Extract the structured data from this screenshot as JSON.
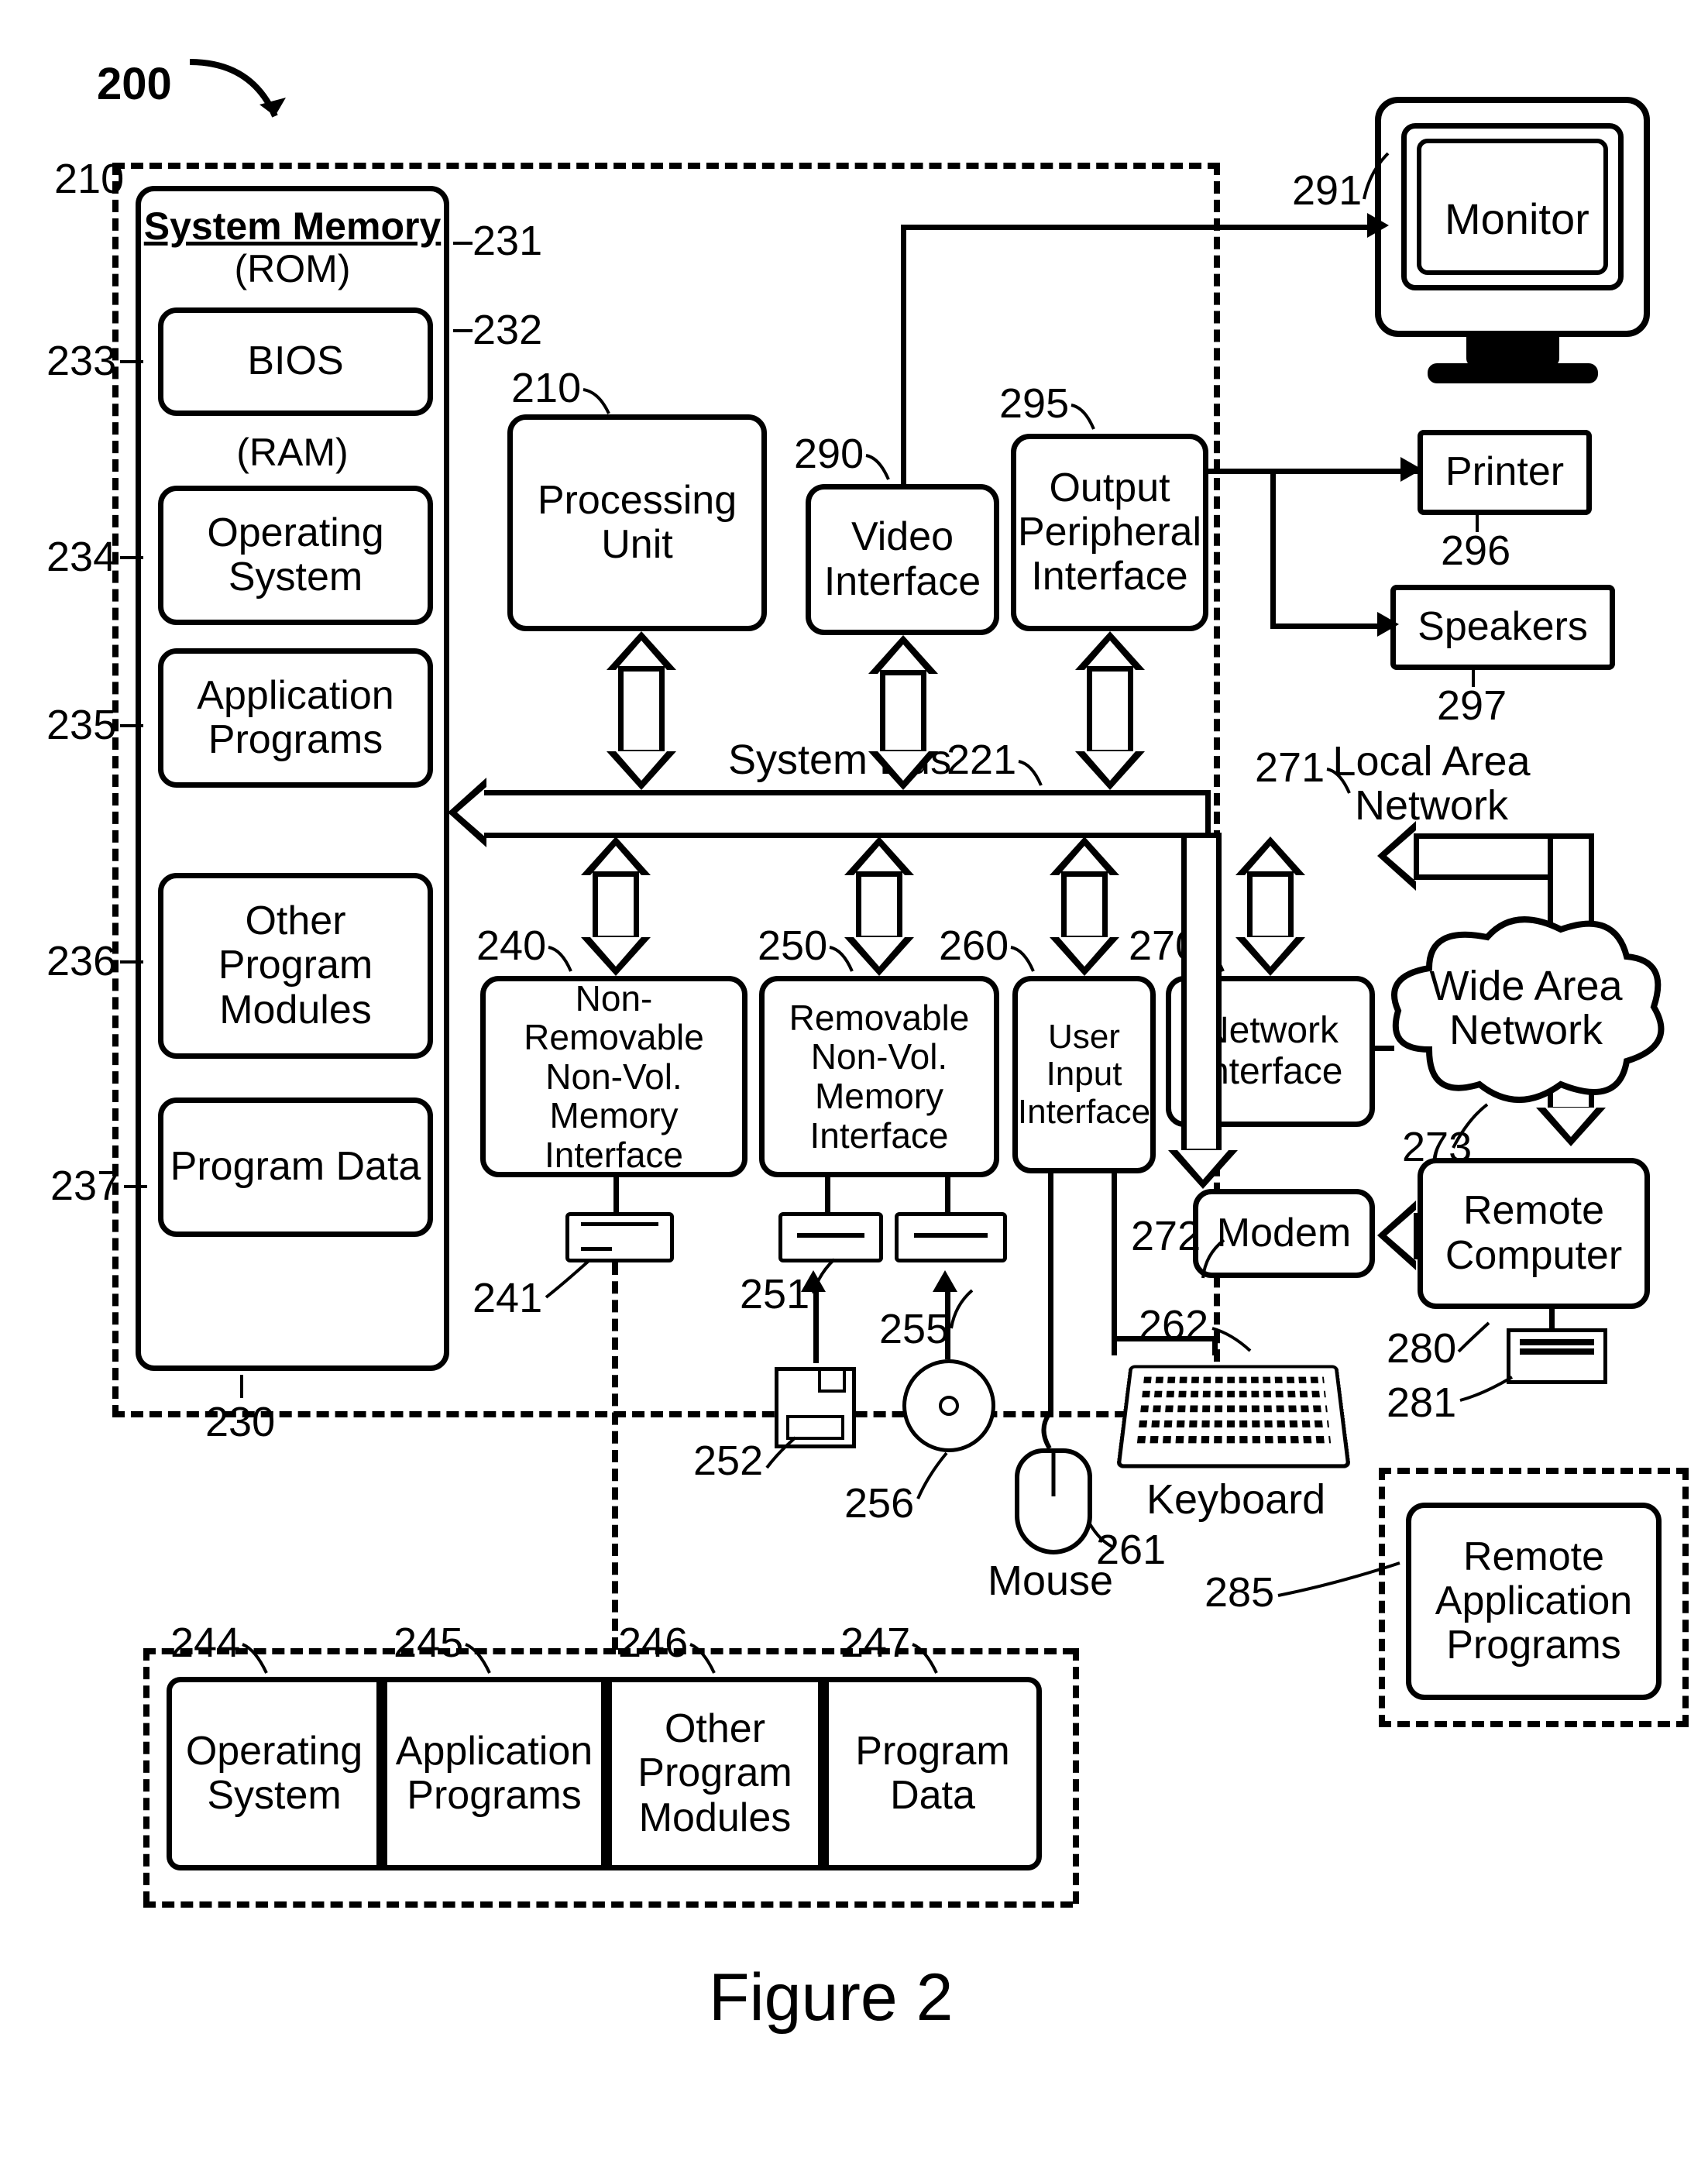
{
  "figure": {
    "number": "200",
    "caption": "Figure 2"
  },
  "boundary_label": "210",
  "system_memory": {
    "title": "System Memory",
    "rom": "(ROM)",
    "bios": "BIOS",
    "ram": "(RAM)",
    "os": "Operating System",
    "apps": "Application Programs",
    "modules": "Other Program Modules",
    "data": "Program Data",
    "n_title": "210",
    "n_rom": "231",
    "n_bios": "233",
    "n_ram": "232",
    "n_os": "234",
    "n_apps": "235",
    "n_modules": "236",
    "n_data": "237",
    "n_outer": "230"
  },
  "processor": {
    "label": "Processing Unit",
    "n": "210"
  },
  "bus": {
    "label": "System Bus",
    "n": "221"
  },
  "video_if": {
    "label": "Video Interface",
    "n": "290"
  },
  "out_periph": {
    "label": "Output Peripheral Interface",
    "n": "295"
  },
  "nonrem_if": {
    "label": "Non-Removable Non-Vol. Memory Interface",
    "n": "240"
  },
  "rem_if": {
    "label": "Removable Non-Vol. Memory Interface",
    "n": "250"
  },
  "usr_if": {
    "label": "User Input Interface",
    "n": "260"
  },
  "net_if": {
    "label": "Network Interface",
    "n": "270"
  },
  "modem": {
    "label": "Modem",
    "n": "272"
  },
  "lan": {
    "label": "Local Area Network",
    "n": "271"
  },
  "wan": {
    "label": "Wide Area Network",
    "n": "273"
  },
  "monitor": {
    "label": "Monitor",
    "n": "291"
  },
  "printer": {
    "label": "Printer",
    "n": "296"
  },
  "speakers": {
    "label": "Speakers",
    "n": "297"
  },
  "hdd": {
    "n": "241"
  },
  "fdd": {
    "n": "251"
  },
  "odd": {
    "n": "255"
  },
  "floppy": {
    "n": "252"
  },
  "cd": {
    "n": "256"
  },
  "mouse": {
    "label": "Mouse",
    "n": "261"
  },
  "keyboard": {
    "label": "Keyboard",
    "n": "262"
  },
  "remote": {
    "label": "Remote Computer",
    "n": "280",
    "dev_n": "281"
  },
  "remote_apps": {
    "label": "Remote Application Programs",
    "n": "285"
  },
  "disk_copies": {
    "os": "Operating System",
    "n_os": "244",
    "apps": "Application Programs",
    "n_apps": "245",
    "modules": "Other Program Modules",
    "n_modules": "246",
    "data": "Program Data",
    "n_data": "247"
  }
}
